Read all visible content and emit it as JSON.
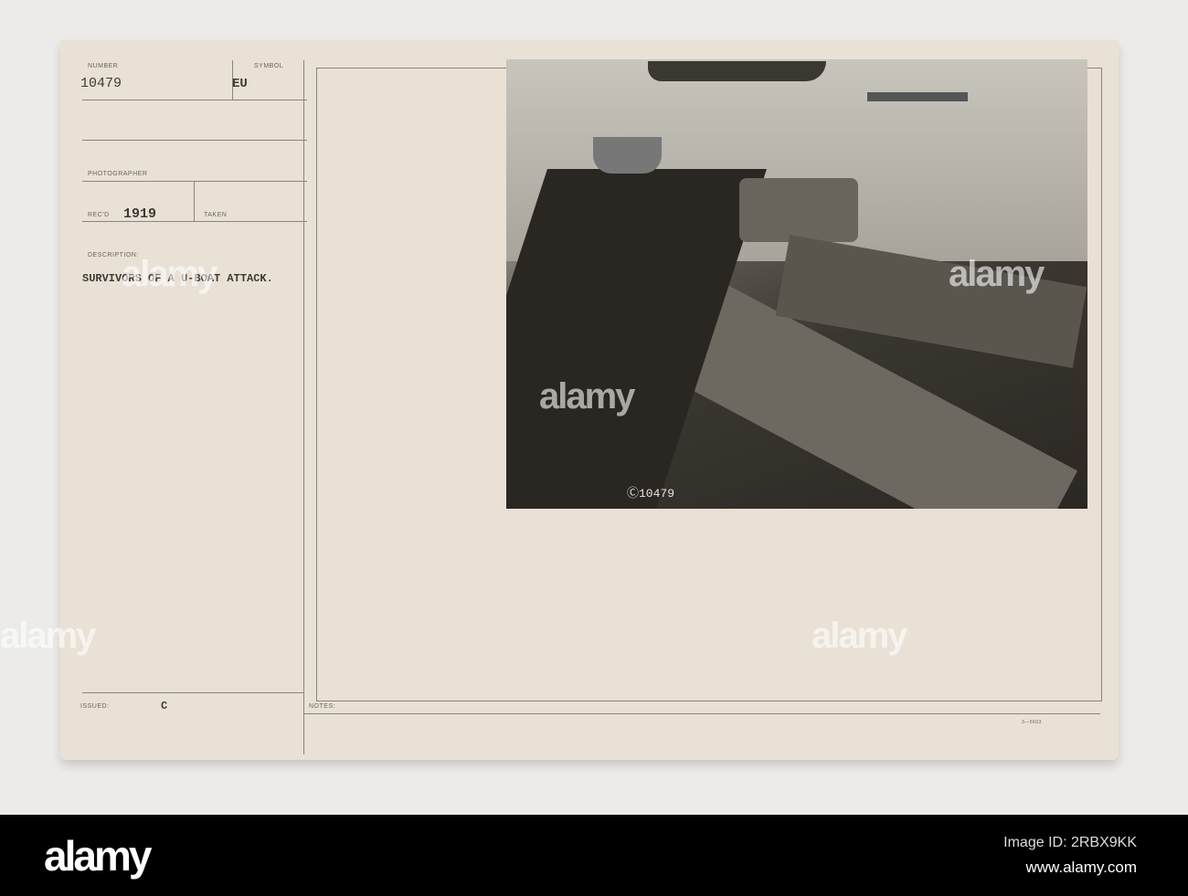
{
  "card": {
    "number_label": "NUMBER",
    "number_value": "10479",
    "symbol_label": "SYMBOL",
    "symbol_value": "EU",
    "photographer_label": "PHOTOGRAPHER",
    "recd_label": "REC'D",
    "recd_value": "1919",
    "taken_label": "TAKEN",
    "description_label": "DESCRIPTION:",
    "description_value": "SURVIVORS OF A U-BOAT ATTACK.",
    "issued_label": "ISSUED:",
    "issued_value": "C",
    "notes_label": "NOTES:",
    "form_code": "3—5603",
    "photo_number": "Ⓒ10479"
  },
  "watermark": {
    "text": "alamy"
  },
  "footer": {
    "logo": "alamy",
    "image_id": "Image ID: 2RBX9KK",
    "url": "www.alamy.com"
  }
}
